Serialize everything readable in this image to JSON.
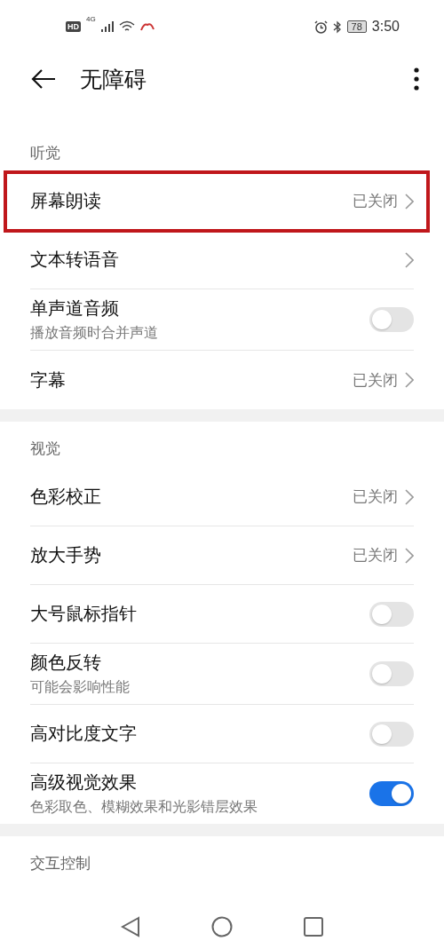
{
  "status_bar": {
    "hd": "HD",
    "network": "4G",
    "battery": "78",
    "time": "3:50"
  },
  "header": {
    "title": "无障碍"
  },
  "sections": [
    {
      "title": "听觉",
      "rows": [
        {
          "kind": "link",
          "title": "屏幕朗读",
          "value": "已关闭",
          "highlighted": true
        },
        {
          "kind": "link",
          "title": "文本转语音",
          "highlighted": false
        },
        {
          "kind": "switch",
          "title": "单声道音频",
          "subtitle": "播放音频时合并声道",
          "on": false,
          "highlighted": false
        },
        {
          "kind": "link",
          "title": "字幕",
          "value": "已关闭",
          "highlighted": false
        }
      ]
    },
    {
      "title": "视觉",
      "rows": [
        {
          "kind": "link",
          "title": "色彩校正",
          "value": "已关闭",
          "highlighted": false
        },
        {
          "kind": "link",
          "title": "放大手势",
          "value": "已关闭",
          "highlighted": false
        },
        {
          "kind": "switch",
          "title": "大号鼠标指针",
          "on": false,
          "highlighted": false
        },
        {
          "kind": "switch",
          "title": "颜色反转",
          "subtitle": "可能会影响性能",
          "on": false,
          "highlighted": false
        },
        {
          "kind": "switch",
          "title": "高对比度文字",
          "on": false,
          "highlighted": false
        },
        {
          "kind": "switch",
          "title": "高级视觉效果",
          "subtitle": "色彩取色、模糊效果和光影错层效果",
          "on": true,
          "highlighted": false
        }
      ]
    },
    {
      "title": "交互控制"
    }
  ]
}
